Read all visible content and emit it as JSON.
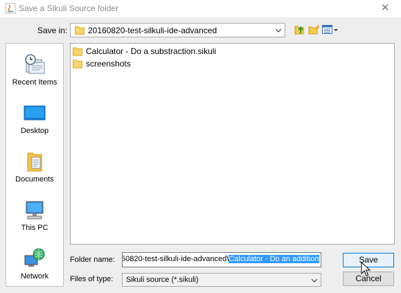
{
  "window": {
    "title": "Save a Sikuli Source folder",
    "close_glyph": "✕"
  },
  "save_in": {
    "label": "Save in:",
    "value": "20160820-test-silkuli-ide-advanced"
  },
  "toolbar": {
    "up_icon": "up-one-level-icon",
    "new_folder_icon": "new-folder-icon",
    "view_menu_icon": "view-menu-icon"
  },
  "places": [
    {
      "label": "Recent Items",
      "icon": "recent-items-icon"
    },
    {
      "label": "Desktop",
      "icon": "desktop-icon"
    },
    {
      "label": "Documents",
      "icon": "documents-icon"
    },
    {
      "label": "This PC",
      "icon": "this-pc-icon"
    },
    {
      "label": "Network",
      "icon": "network-icon"
    }
  ],
  "files": [
    {
      "name": "Calculator - Do a substraction.sikuli"
    },
    {
      "name": "screenshots"
    }
  ],
  "folder_name": {
    "label": "Folder name:",
    "value_prefix": "50820-test-silkuli-ide-advanced\\",
    "value_selected": "Calculator - Do an addition"
  },
  "files_of_type": {
    "label": "Files of type:",
    "value": "Sikuli source (*.sikuli)"
  },
  "buttons": {
    "save": "Save",
    "cancel": "Cancel"
  },
  "colors": {
    "accent": "#0078d7",
    "selection": "#3399ff",
    "folder": "#f4c94e"
  }
}
